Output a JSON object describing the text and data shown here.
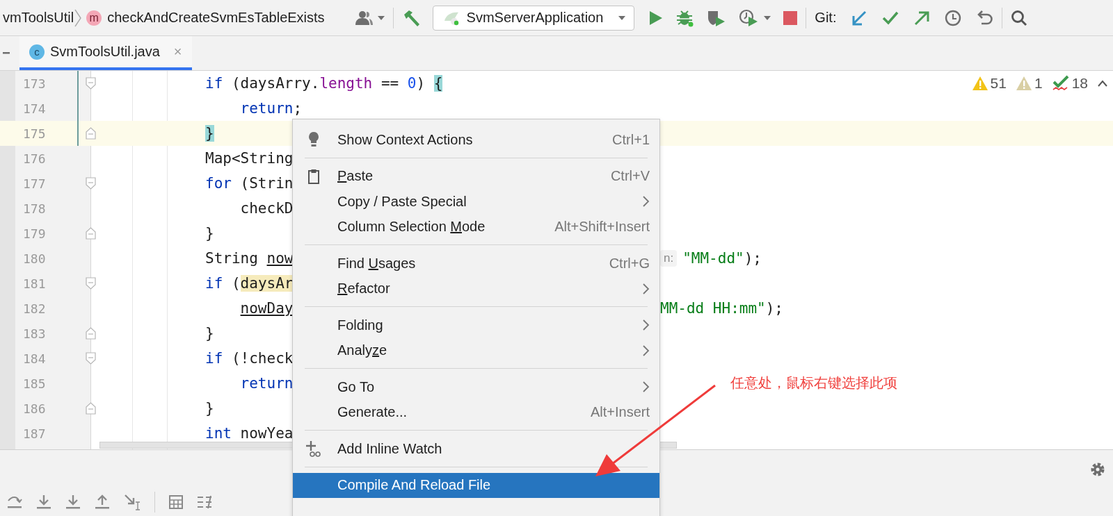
{
  "toolbar": {
    "breadcrumbs": [
      {
        "label": "vmToolsUtil",
        "kind": "class"
      },
      {
        "label": "checkAndCreateSvmEsTableExists",
        "kind": "method",
        "badge": "m"
      }
    ],
    "run_config": "SvmServerApplication",
    "git_label": "Git:"
  },
  "tabs": [
    {
      "label": "SvmToolsUtil.java",
      "selected": true,
      "badge": "c",
      "close": "×"
    }
  ],
  "editor": {
    "inspections": [
      {
        "kind": "warning",
        "count": "51"
      },
      {
        "kind": "weak_warning",
        "count": "1"
      },
      {
        "kind": "typo",
        "count": "18"
      }
    ],
    "lines": [
      {
        "number": "173",
        "kind": "fold_start",
        "changed": true,
        "current": false,
        "tokens": [
          {
            "kind": "kw",
            "t": "if"
          },
          {
            "kind": "plain",
            "t": " (daysArry."
          },
          {
            "kind": "field",
            "t": "length"
          },
          {
            "kind": "plain",
            "t": " == "
          },
          {
            "kind": "num",
            "t": "0"
          },
          {
            "kind": "plain",
            "t": ") "
          },
          {
            "kind": "match",
            "t": "{"
          }
        ]
      },
      {
        "number": "174",
        "kind": "plain",
        "changed": true,
        "current": false,
        "tokens": [
          {
            "kind": "kw",
            "t": "    return"
          },
          {
            "kind": "plain",
            "t": ";"
          }
        ]
      },
      {
        "number": "175",
        "kind": "fold_end",
        "changed": true,
        "current": true,
        "tokens": [
          {
            "kind": "match",
            "t": "}"
          }
        ]
      },
      {
        "number": "176",
        "kind": "plain",
        "changed": false,
        "current": false,
        "tokens": [
          {
            "kind": "plain",
            "t": "Map<String"
          }
        ]
      },
      {
        "number": "177",
        "kind": "fold_start",
        "changed": false,
        "current": false,
        "tokens": [
          {
            "kind": "kw",
            "t": "for"
          },
          {
            "kind": "plain",
            "t": " (Strin"
          }
        ]
      },
      {
        "number": "178",
        "kind": "plain",
        "changed": false,
        "current": false,
        "tokens": [
          {
            "kind": "plain",
            "t": "    checkD"
          }
        ]
      },
      {
        "number": "179",
        "kind": "fold_end",
        "changed": false,
        "current": false,
        "tokens": [
          {
            "kind": "plain",
            "t": "}"
          }
        ]
      },
      {
        "number": "180",
        "kind": "plain",
        "changed": false,
        "current": false,
        "tokens": [
          {
            "kind": "plain",
            "t": "String "
          },
          {
            "kind": "under",
            "t": "now"
          }
        ],
        "tail": [
          {
            "kind": "hint",
            "t": "n:"
          },
          {
            "kind": "str",
            "t": "\"MM-dd\""
          },
          {
            "kind": "plain",
            "t": ");"
          }
        ]
      },
      {
        "number": "181",
        "kind": "fold_start",
        "changed": false,
        "current": false,
        "tokens": [
          {
            "kind": "kw",
            "t": "if"
          },
          {
            "kind": "plain",
            "t": " ("
          },
          {
            "kind": "usage",
            "t": "daysAr"
          }
        ]
      },
      {
        "number": "182",
        "kind": "plain",
        "changed": false,
        "current": false,
        "tokens": [
          {
            "kind": "under_indented",
            "t": "nowDay"
          }
        ],
        "tail": [
          {
            "kind": "str",
            "t": "MM-dd HH:mm\""
          },
          {
            "kind": "plain",
            "t": ");"
          }
        ]
      },
      {
        "number": "183",
        "kind": "fold_end",
        "changed": false,
        "current": false,
        "tokens": [
          {
            "kind": "plain",
            "t": "}"
          }
        ]
      },
      {
        "number": "184",
        "kind": "fold_start",
        "changed": false,
        "current": false,
        "tokens": [
          {
            "kind": "kw",
            "t": "if"
          },
          {
            "kind": "plain",
            "t": " (!check"
          }
        ]
      },
      {
        "number": "185",
        "kind": "plain",
        "changed": false,
        "current": false,
        "tokens": [
          {
            "kind": "kw",
            "t": "    return"
          }
        ]
      },
      {
        "number": "186",
        "kind": "fold_end",
        "changed": false,
        "current": false,
        "tokens": [
          {
            "kind": "plain",
            "t": "}"
          }
        ]
      },
      {
        "number": "187",
        "kind": "plain",
        "changed": false,
        "current": false,
        "tokens": [
          {
            "kind": "kw",
            "t": "int"
          },
          {
            "kind": "plain",
            "t": " nowYea"
          }
        ]
      }
    ]
  },
  "context_menu": {
    "groups": [
      [
        {
          "label": "Show Context Actions",
          "shortcut": "Ctrl+1",
          "kind": "intention",
          "submenu": false,
          "selected": false
        }
      ],
      [
        {
          "label_parts": {
            "key": "P",
            "after": "aste"
          },
          "shortcut": "Ctrl+V",
          "kind": "paste",
          "submenu": false,
          "selected": false
        },
        {
          "label": "Copy / Paste Special",
          "kind": "plain",
          "submenu": true,
          "selected": false
        },
        {
          "label_parts": {
            "before": "Column Selection ",
            "key": "M",
            "after": "ode"
          },
          "shortcut": "Alt+Shift+Insert",
          "kind": "plain",
          "submenu": false,
          "selected": false
        }
      ],
      [
        {
          "label_parts": {
            "before": "Find ",
            "key": "U",
            "after": "sages"
          },
          "shortcut": "Ctrl+G",
          "kind": "plain",
          "submenu": false,
          "selected": false
        },
        {
          "label_parts": {
            "key": "R",
            "after": "efactor"
          },
          "kind": "plain",
          "submenu": true,
          "selected": false
        }
      ],
      [
        {
          "label": "Folding",
          "kind": "plain",
          "submenu": true,
          "selected": false
        },
        {
          "label_parts": {
            "before": "Analy",
            "key": "z",
            "after": "e"
          },
          "kind": "plain",
          "submenu": true,
          "selected": false
        }
      ],
      [
        {
          "label": "Go To",
          "kind": "plain",
          "submenu": true,
          "selected": false
        },
        {
          "label": "Generate...",
          "shortcut": "Alt+Insert",
          "kind": "plain",
          "submenu": false,
          "selected": false
        }
      ],
      [
        {
          "label": "Add Inline Watch",
          "kind": "watch",
          "submenu": false,
          "selected": false
        }
      ],
      [
        {
          "label": "Compile And Reload File",
          "kind": "plain",
          "submenu": false,
          "selected": true
        }
      ]
    ]
  },
  "annotation": {
    "text": "任意处，鼠标右键选择此项"
  }
}
